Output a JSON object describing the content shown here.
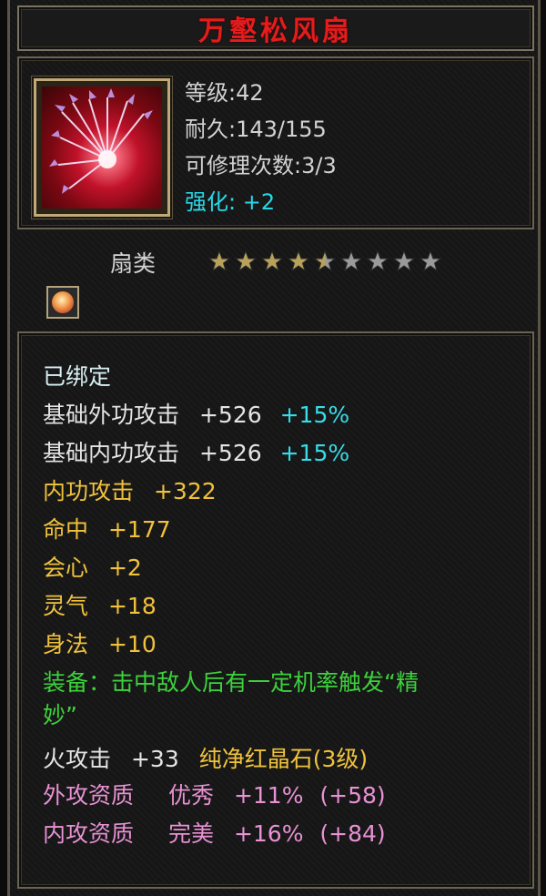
{
  "item": {
    "name": "万壑松风扇",
    "level": "等级:42",
    "durability": "耐久:143/155",
    "repair": "可修理次数:3/3",
    "enhance_label": "强化:",
    "enhance_value": "+2",
    "category": "扇类",
    "stars": {
      "filled": 4.5,
      "total": 9
    },
    "bound": "已绑定",
    "stats": [
      {
        "label": "基础外功攻击",
        "value": "+526",
        "bonus": "+15%"
      },
      {
        "label": "基础内功攻击",
        "value": "+526",
        "bonus": "+15%"
      },
      {
        "label": "内功攻击",
        "value": "+322"
      },
      {
        "label": "命中",
        "value": "+177"
      },
      {
        "label": "会心",
        "value": "+2"
      },
      {
        "label": "灵气",
        "value": "+18"
      },
      {
        "label": "身法",
        "value": "+10"
      }
    ],
    "equip_effect_line1": "装备：击中敌人后有一定机率触发“精",
    "equip_effect_line2": "妙”",
    "gem": {
      "label": "火攻击",
      "value": "+33",
      "gem_name": "纯净红晶石(3级)"
    },
    "qualities": [
      {
        "label": "外攻资质",
        "grade": "优秀",
        "pct": "+11%",
        "paren": "(+58)"
      },
      {
        "label": "内攻资质",
        "grade": "完美",
        "pct": "+16%",
        "paren": "(+84)"
      }
    ],
    "colors": {
      "title": "#e41c1c",
      "cyan": "#38dce8",
      "yellow": "#f0c23c",
      "green": "#3cd23c",
      "pink": "#e891d4",
      "star_gold": "#b8a25a",
      "star_gray": "#9a9a9a"
    }
  }
}
